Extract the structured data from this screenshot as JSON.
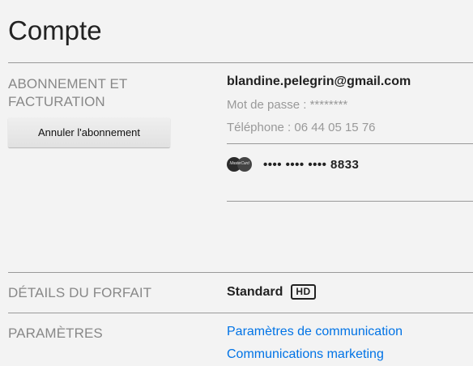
{
  "page": {
    "title": "Compte"
  },
  "membership": {
    "section_label": "ABONNEMENT ET FACTURATION",
    "cancel_button": "Annuler l'abonnement",
    "email": "blandine.pelegrin@gmail.com",
    "password_label": "Mot de passe : ",
    "password_value": "********",
    "phone_label": "Téléphone : ",
    "phone_value": "06 44 05 15 76",
    "card": {
      "brand_icon": "mastercard-icon",
      "brand_text": "MasterCard",
      "number": "•••• •••• •••• 8833"
    }
  },
  "plan": {
    "section_label": "DÉTAILS DU FORFAIT",
    "name": "Standard",
    "badge": "HD"
  },
  "settings": {
    "section_label": "PARAMÈTRES",
    "links": [
      "Paramètres de communication",
      "Communications marketing"
    ]
  },
  "colors": {
    "background": "#f3f3f3",
    "link": "#0073e6",
    "section_label": "#888888",
    "divider": "#999999"
  }
}
